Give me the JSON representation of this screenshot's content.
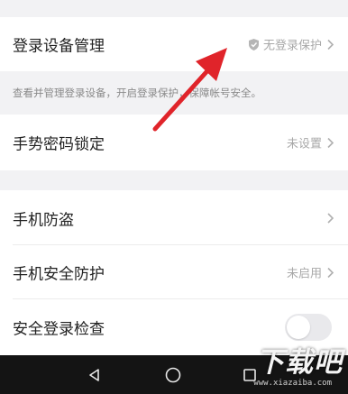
{
  "rows": {
    "login_devices": {
      "label": "登录设备管理",
      "status": "无登录保护"
    },
    "login_devices_desc": "查看并管理登录设备，开启登录保护，保障帐号安全。",
    "gesture_lock": {
      "label": "手势密码锁定",
      "status": "未设置"
    },
    "phone_antitheft": {
      "label": "手机防盗"
    },
    "phone_security": {
      "label": "手机安全防护",
      "status": "未启用"
    },
    "safe_login_check": {
      "label": "安全登录检查",
      "toggle_on": false
    }
  },
  "watermark": {
    "text": "下载吧",
    "url": "www.xiazaiba.com"
  },
  "colors": {
    "background": "#f2f2f4",
    "row": "#ffffff",
    "annotation_arrow": "#e0242a",
    "navbar": "#141414"
  },
  "icons": [
    "shield-icon",
    "chevron-right-icon",
    "back-icon",
    "home-icon",
    "recents-icon"
  ]
}
